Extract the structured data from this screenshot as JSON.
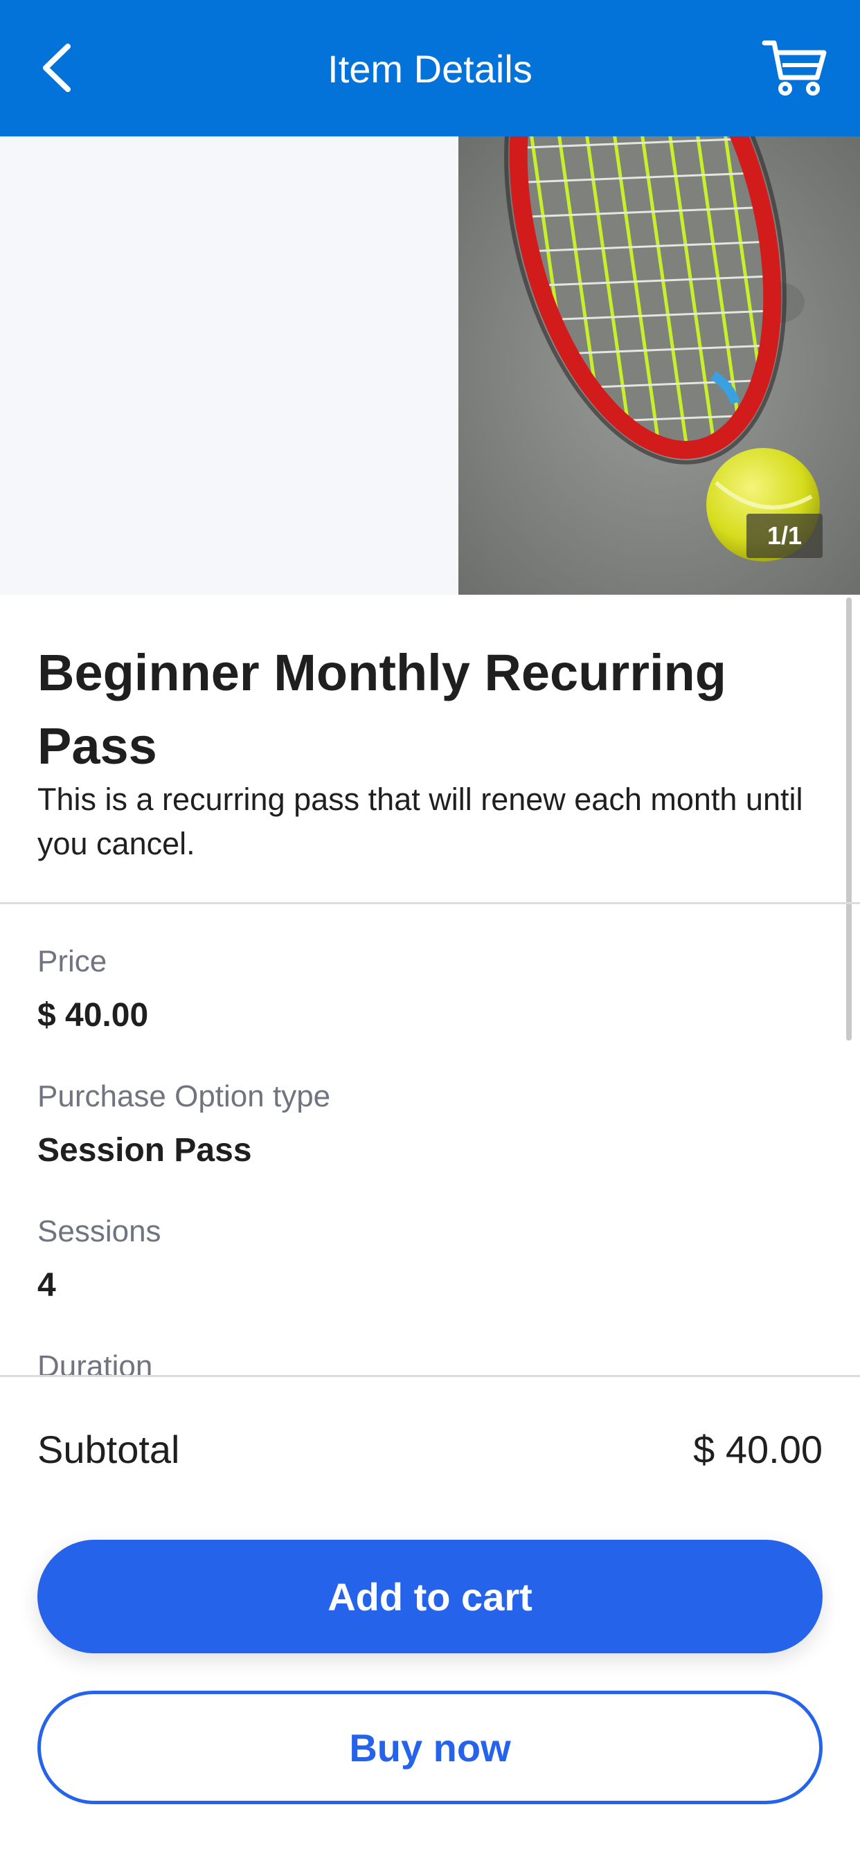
{
  "header": {
    "title": "Item Details",
    "back_icon": "chevron-left-icon",
    "cart_icon": "cart-icon",
    "background_color": "#0373D9"
  },
  "carousel": {
    "indicator": "1/1"
  },
  "item": {
    "title": "Beginner Monthly Recurring Pass",
    "description": "This is a recurring pass that will renew each month until you cancel."
  },
  "details": [
    {
      "label": "Price",
      "value": "$ 40.00"
    },
    {
      "label": "Purchase Option type",
      "value": "Session Pass"
    },
    {
      "label": "Sessions",
      "value": "4"
    },
    {
      "label": "Duration",
      "value": ""
    }
  ],
  "summary": {
    "subtotal_label": "Subtotal",
    "subtotal_value": "$ 40.00"
  },
  "actions": {
    "add_to_cart": "Add to cart",
    "buy_now": "Buy now",
    "accent_color": "#2563EB"
  }
}
